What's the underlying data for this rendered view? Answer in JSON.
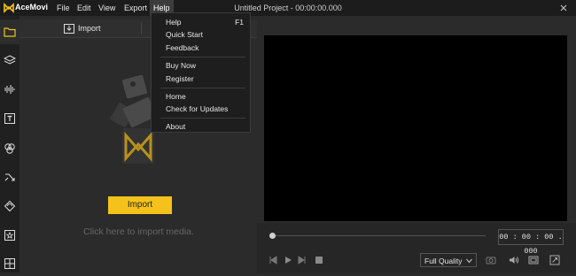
{
  "app": {
    "name": "AceMovi",
    "window_title": "Untitled Project - 00:00:00.000"
  },
  "menubar": {
    "items": [
      "File",
      "Edit",
      "View",
      "Export",
      "Help"
    ]
  },
  "sidebar": {
    "icons": [
      "folder-icon",
      "layers-icon",
      "audio-icon",
      "text-icon",
      "effects-icon",
      "transition-icon",
      "sticker-icon",
      "star-icon",
      "grid-icon"
    ]
  },
  "media": {
    "import_tab": "Import",
    "import_button": "Import",
    "hint": "Click here to import media."
  },
  "preview": {
    "timecode": "00 : 00 : 00 . 000",
    "quality": "Full Quality"
  },
  "help_menu": {
    "items": [
      {
        "label": "Help",
        "shortcut": "F1"
      },
      {
        "label": "Quick Start"
      },
      {
        "label": "Feedback"
      },
      {
        "label": "Buy Now"
      },
      {
        "label": "Register"
      },
      {
        "label": "Home"
      },
      {
        "label": "Check for Updates"
      },
      {
        "label": "About"
      }
    ]
  },
  "colors": {
    "accent": "#f5c21b",
    "titlebar": "#1c1c1c",
    "panel": "#2b2b2b",
    "screen": "#000000"
  }
}
